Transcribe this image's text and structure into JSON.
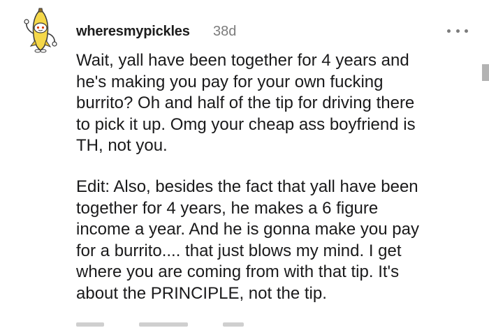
{
  "comment": {
    "author": "wheresmypickles",
    "age": "38d",
    "paragraphs": [
      {
        "lines": [
          "Wait, yall have been together for 4 years and",
          "he's making you pay for your own fucking",
          "burrito? Oh and half of the tip for driving there",
          "to pick it up. Omg your cheap ass boyfriend is",
          "TH, not you."
        ]
      },
      {
        "lines": [
          "Edit: Also, besides the fact that yall have been",
          "together for 4 years, he makes a 6 figure",
          "income a year. And he is gonna make you pay",
          "for a burrito.... that just blows my mind. I get",
          "where you are coming from with that tip. It's",
          "about the PRINCIPLE, not the tip."
        ]
      }
    ],
    "avatar_icon": "banana-snoo-avatar-icon",
    "more_icon": "more-options-icon"
  },
  "colors": {
    "username": "#1c1c1c",
    "meta": "#7c7c7c",
    "body_text": "#1a1a1b",
    "avatar_yellow": "#f5d84a"
  }
}
